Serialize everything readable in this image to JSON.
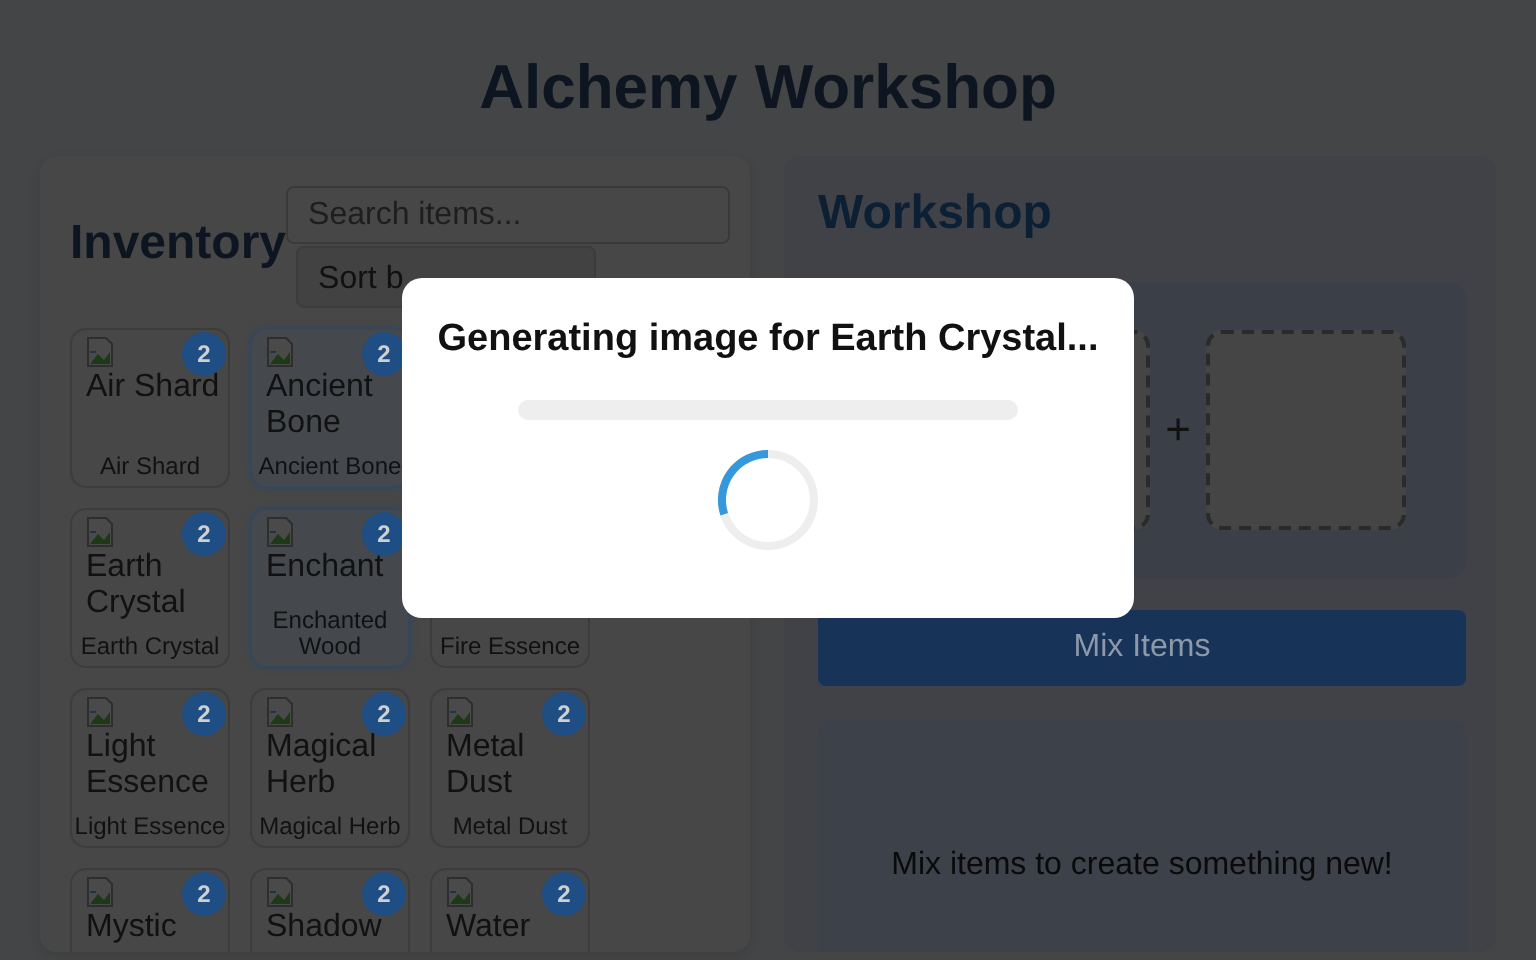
{
  "title": "Alchemy Workshop",
  "inventory": {
    "heading": "Inventory",
    "search": {
      "placeholder": "Search items..."
    },
    "sort": {
      "value": "Sort b"
    },
    "rows": [
      {
        "items": [
          {
            "image_alt": "Air Shard",
            "label": "Air Shard",
            "count": "2",
            "selected": false
          },
          {
            "image_alt": "Ancient Bone",
            "label": "Ancient Bone",
            "count": "2",
            "selected": true
          }
        ]
      },
      {
        "items": [
          {
            "image_alt": "Earth Crystal",
            "label": "Earth Crystal",
            "count": "2",
            "selected": false
          },
          {
            "image_alt": "Enchant",
            "label": "Enchanted Wood",
            "count": "2",
            "selected": true
          },
          {
            "label": "Fire Essence",
            "selected": false
          }
        ]
      },
      {
        "items": [
          {
            "image_alt": "Light Essence",
            "label": "Light Essence",
            "count": "2",
            "selected": false
          },
          {
            "image_alt": "Magical Herb",
            "label": "Magical Herb",
            "count": "2",
            "selected": false
          },
          {
            "image_alt": "Metal Dust",
            "label": "Metal Dust",
            "count": "2",
            "selected": false
          }
        ]
      },
      {
        "items": [
          {
            "image_alt": "Mystic",
            "count": "2",
            "selected": false
          },
          {
            "image_alt": "Shadow",
            "count": "2",
            "selected": false
          },
          {
            "image_alt": "Water",
            "count": "2",
            "selected": false
          }
        ]
      }
    ]
  },
  "workshop": {
    "heading": "Workshop",
    "slots": [
      {
        "empty": true
      },
      {
        "empty": true
      }
    ],
    "operator": "+",
    "mix_button": {
      "label": "Mix Items",
      "disabled": true
    },
    "result": {
      "message": "Mix items to create something new!"
    }
  },
  "modal": {
    "message": "Generating image for Earth Crystal...",
    "progress": {
      "level": 0
    }
  }
}
